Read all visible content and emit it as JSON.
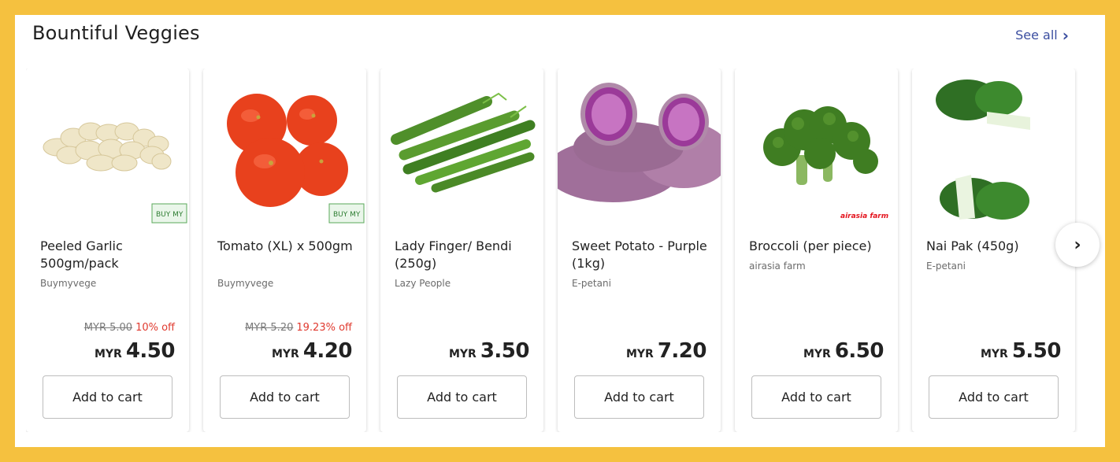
{
  "section": {
    "title": "Bountiful Veggies",
    "see_all_label": "See all",
    "see_all_icon": "chevron-right-icon",
    "next_icon": "chevron-right-icon",
    "next_glyph": "›"
  },
  "products": [
    {
      "name": "Peeled Garlic 500gm/pack",
      "seller": "Buymyvege",
      "old_price": "MYR 5.00",
      "discount": "10% off",
      "currency": "MYR",
      "price": "4.50",
      "button": "Add to cart",
      "image": "garlic-image",
      "badge": "BUY MY VEGE"
    },
    {
      "name": "Tomato (XL) x 500gm",
      "seller": "Buymyvege",
      "old_price": "MYR 5.20",
      "discount": "19.23% off",
      "currency": "MYR",
      "price": "4.20",
      "button": "Add to cart",
      "image": "tomato-image",
      "badge": "BUY MY VEGE"
    },
    {
      "name": "Lady Finger/ Bendi (250g)",
      "seller": "Lazy People",
      "old_price": "",
      "discount": "",
      "currency": "MYR",
      "price": "3.50",
      "button": "Add to cart",
      "image": "okra-image",
      "badge": ""
    },
    {
      "name": "Sweet Potato - Purple (1kg)",
      "seller": "E-petani",
      "old_price": "",
      "discount": "",
      "currency": "MYR",
      "price": "7.20",
      "button": "Add to cart",
      "image": "sweet-potato-image",
      "badge": ""
    },
    {
      "name": "Broccoli (per piece)",
      "seller": "airasia farm",
      "old_price": "",
      "discount": "",
      "currency": "MYR",
      "price": "6.50",
      "button": "Add to cart",
      "image": "broccoli-image",
      "badge": "airasia farm"
    },
    {
      "name": "Nai Pak (450g)",
      "seller": "E-petani",
      "old_price": "",
      "discount": "",
      "currency": "MYR",
      "price": "5.50",
      "button": "Add to cart",
      "image": "nai-pak-image",
      "badge": ""
    }
  ],
  "colors": {
    "background": "#f5c13f",
    "link": "#3b4ea0",
    "discount": "#e03a2f"
  }
}
